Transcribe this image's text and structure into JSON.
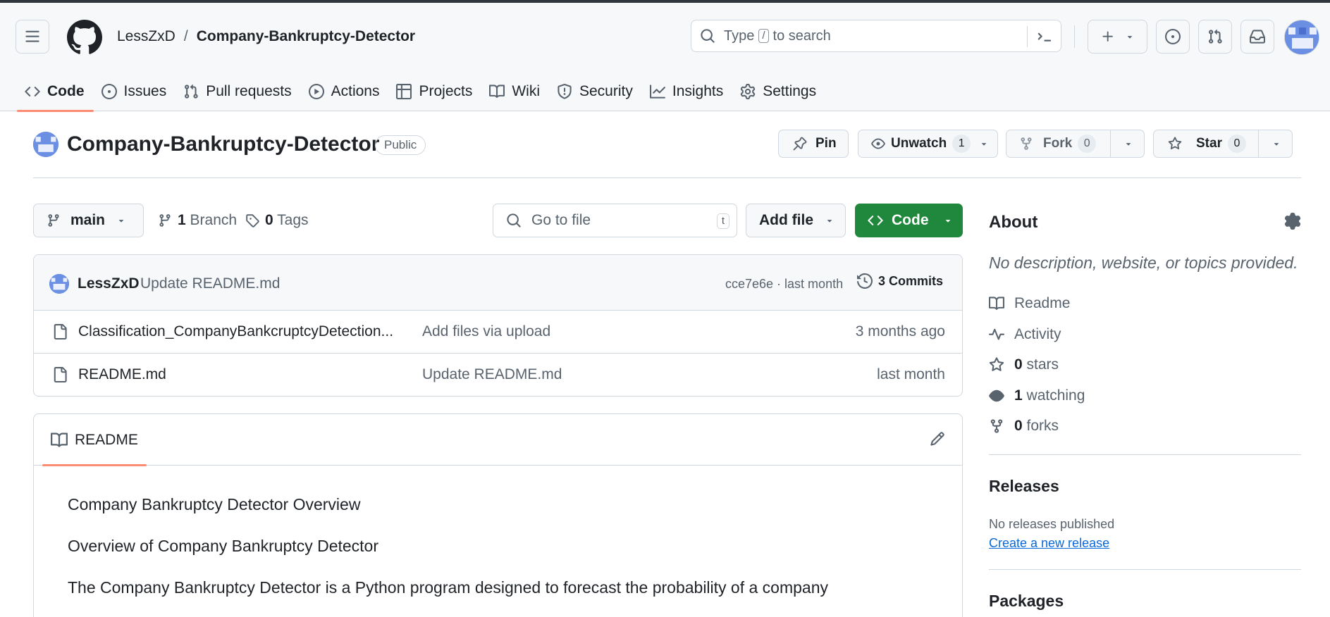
{
  "header": {
    "owner": "LessZxD",
    "separator": "/",
    "repo": "Company-Bankruptcy-Detector",
    "search_prefix": "Type",
    "search_key": "/",
    "search_suffix": "to search"
  },
  "tabs": [
    {
      "label": "Code",
      "icon": "code-icon"
    },
    {
      "label": "Issues",
      "icon": "issue-icon"
    },
    {
      "label": "Pull requests",
      "icon": "pull-request-icon"
    },
    {
      "label": "Actions",
      "icon": "play-icon"
    },
    {
      "label": "Projects",
      "icon": "table-icon"
    },
    {
      "label": "Wiki",
      "icon": "book-icon"
    },
    {
      "label": "Security",
      "icon": "shield-icon"
    },
    {
      "label": "Insights",
      "icon": "graph-icon"
    },
    {
      "label": "Settings",
      "icon": "gear-icon"
    }
  ],
  "repo": {
    "title": "Company-Bankruptcy-Detector",
    "visibility": "Public",
    "pin_label": "Pin",
    "unwatch_label": "Unwatch",
    "unwatch_count": "1",
    "fork_label": "Fork",
    "fork_count": "0",
    "star_label": "Star",
    "star_count": "0"
  },
  "controls": {
    "branch": "main",
    "branches_count": "1",
    "branches_label": "Branch",
    "tags_count": "0",
    "tags_label": "Tags",
    "goto_placeholder": "Go to file",
    "goto_key": "t",
    "add_file": "Add file",
    "code": "Code"
  },
  "commit": {
    "author": "LessZxD",
    "message": "Update README.md",
    "meta": "cce7e6e · last month",
    "commits": "3 Commits"
  },
  "files": [
    {
      "name": "Classification_CompanyBankcruptcyDetection...",
      "message": "Add files via upload",
      "date": "3 months ago"
    },
    {
      "name": "README.md",
      "message": "Update README.md",
      "date": "last month"
    }
  ],
  "readme": {
    "tab": "README",
    "paragraphs": [
      "Company Bankruptcy Detector Overview",
      "Overview of Company Bankruptcy Detector",
      "The Company Bankruptcy Detector is a Python program designed to forecast the probability of a company"
    ]
  },
  "about": {
    "title": "About",
    "description": "No description, website, or topics provided.",
    "readme": "Readme",
    "activity": "Activity",
    "stars_count": "0",
    "stars_label": "stars",
    "watching_count": "1",
    "watching_label": "watching",
    "forks_count": "0",
    "forks_label": "forks"
  },
  "releases": {
    "title": "Releases",
    "none": "No releases published",
    "create": "Create a new release"
  },
  "packages": {
    "title": "Packages"
  },
  "colors": {
    "accent_underline": "#fd8c73",
    "code_button": "#1f883d",
    "link": "#0969da"
  }
}
